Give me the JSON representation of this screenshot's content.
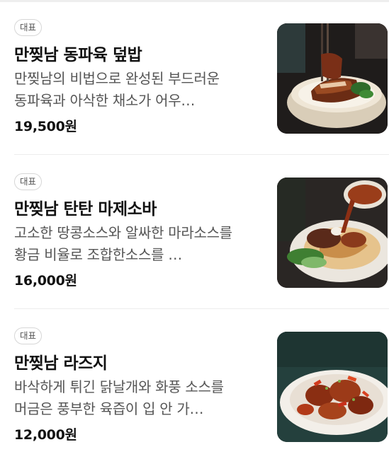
{
  "menu": {
    "items": [
      {
        "badge": "대표",
        "name": "만찢남 동파육 덮밥",
        "description": "만찢남의 비법으로 완성된 부드러운 동파육과 아삭한 채소가 어우…",
        "price": "19,500원",
        "image_icon": "dongpayuk-rice-bowl-photo"
      },
      {
        "badge": "대표",
        "name": "만찢남 탄탄 마제소바",
        "description": "고소한 땅콩소스와 알싸한 마라소스를 황금 비율로 조합한소스를 …",
        "price": "16,000원",
        "image_icon": "tantan-mazesoba-photo"
      },
      {
        "badge": "대표",
        "name": "만찢남 라즈지",
        "description": "바삭하게 튀긴 닭날개와 화풍 소스를 머금은 풍부한 육즙이 입 안 가…",
        "price": "12,000원",
        "image_icon": "lazziji-chicken-photo"
      }
    ]
  },
  "colors": {
    "text_primary": "#111111",
    "text_secondary": "#555555",
    "divider": "#ededed",
    "badge_border": "#d6d6d6"
  }
}
